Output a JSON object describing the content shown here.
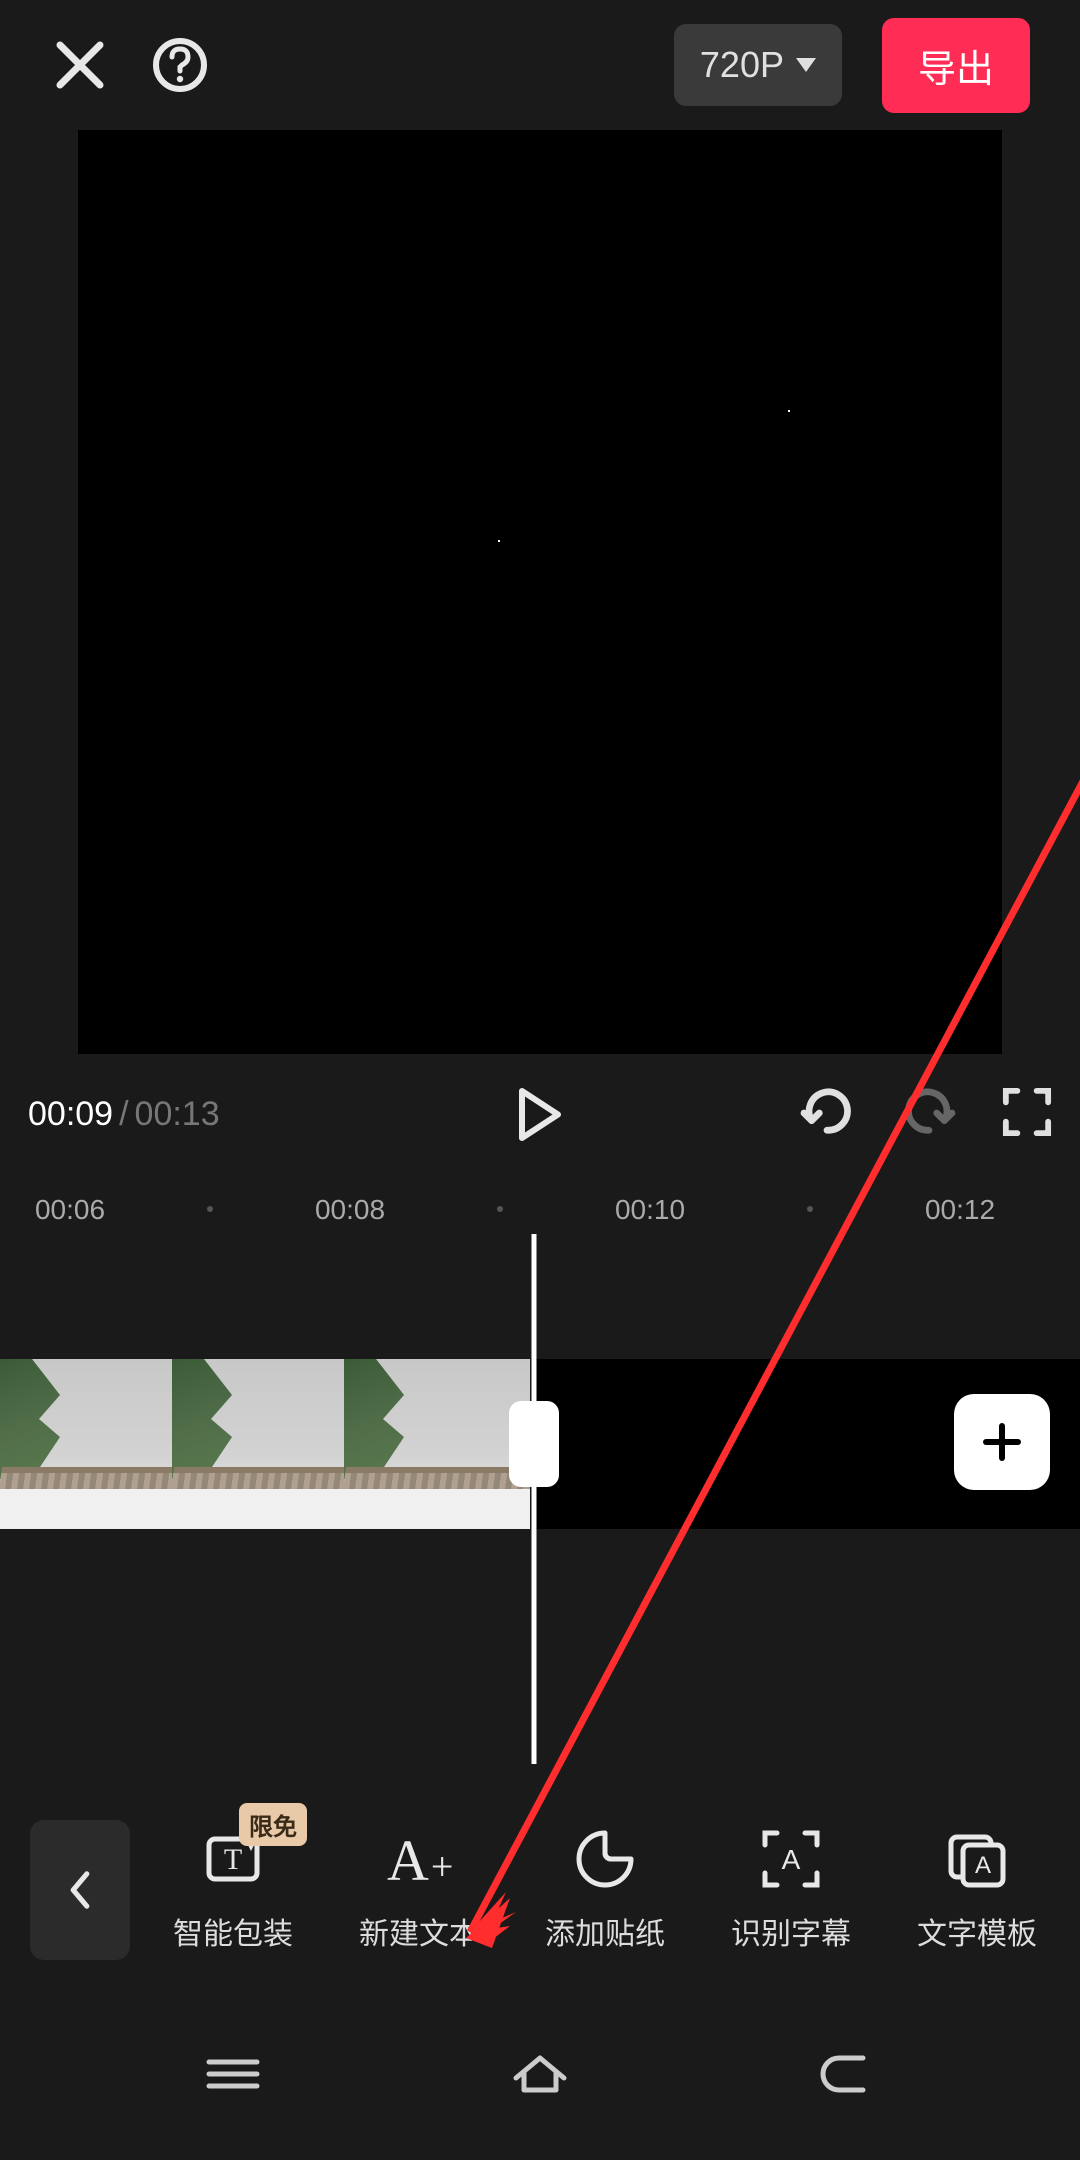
{
  "header": {
    "resolution": "720P",
    "export_label": "导出"
  },
  "transport": {
    "current_time": "00:09",
    "total_time": "00:13"
  },
  "ruler": {
    "ticks": [
      "00:06",
      "00:08",
      "00:10",
      "00:12"
    ]
  },
  "toolbar": {
    "back_icon": "chevron-left",
    "items": [
      {
        "label": "智能包装",
        "badge": "限免",
        "icon": "smart-package"
      },
      {
        "label": "新建文本",
        "icon": "new-text"
      },
      {
        "label": "添加贴纸",
        "icon": "add-sticker"
      },
      {
        "label": "识别字幕",
        "icon": "recognize-subtitles"
      },
      {
        "label": "文字模板",
        "icon": "text-template"
      }
    ]
  },
  "add_clip_icon": "+",
  "system_nav": [
    "menu",
    "home",
    "back"
  ]
}
